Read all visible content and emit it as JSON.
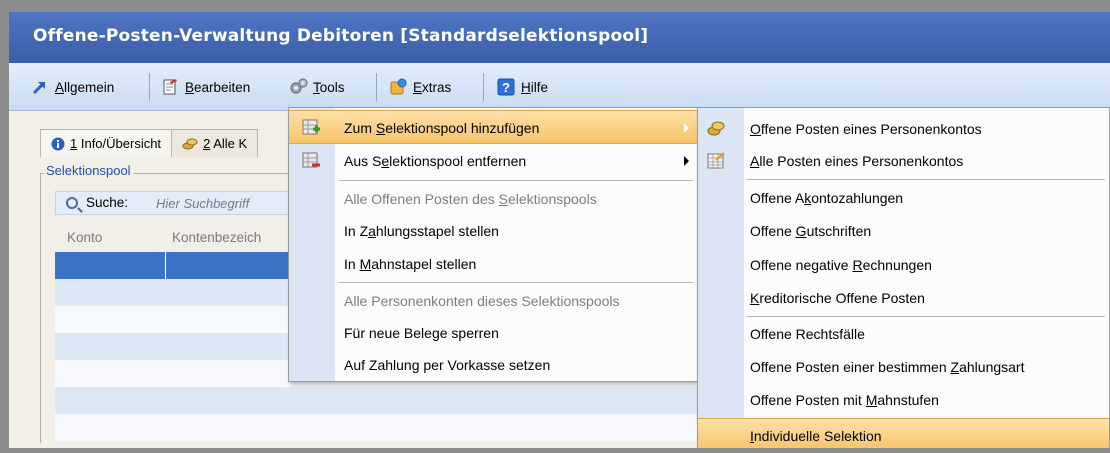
{
  "window": {
    "title": "Offene-Posten-Verwaltung Debitoren [Standardselektionspool]"
  },
  "toolbar": {
    "items": [
      {
        "label": "Allgemein",
        "accel": "A",
        "rest": "llgemein",
        "icon": "arrow-up-right-icon"
      },
      {
        "label": "Bearbeiten",
        "accel": "B",
        "rest": "earbeiten",
        "icon": "edit-icon"
      },
      {
        "label": "Tools",
        "accel": "T",
        "rest": "ools",
        "icon": "gears-icon"
      },
      {
        "label": "Extras",
        "accel": "E",
        "rest": "xtras",
        "icon": "extras-icon"
      },
      {
        "label": "Hilfe",
        "accel": "H",
        "rest": "ilfe",
        "icon": "help-icon"
      }
    ]
  },
  "tabs": [
    {
      "accel": "1",
      "rest": " Info/Übersicht",
      "icon": "info-icon"
    },
    {
      "accel": "2",
      "rest": " Alle K",
      "icon": "coins-icon"
    }
  ],
  "selektionspool": {
    "title": "Selektionspool",
    "search_label": "Suche:",
    "search_placeholder": "Hier Suchbegriff",
    "columns": [
      "Konto",
      "Kontenbezeich"
    ]
  },
  "menu_main": {
    "items": [
      {
        "pre": "Zum ",
        "accel": "S",
        "post": "elektionspool hinzufügen",
        "highlighted": true,
        "submenu": true,
        "icon": "add-pool-icon"
      },
      {
        "pre": "Aus S",
        "accel": "e",
        "post": "lektionspool entfernen",
        "submenu": true,
        "icon": "remove-pool-icon"
      },
      {
        "pre": "Alle Offenen Posten des ",
        "accel": "S",
        "post": "elektionspools",
        "disabled": true
      },
      {
        "pre": "In Z",
        "accel": "a",
        "post": "hlungsstapel stellen"
      },
      {
        "pre": "In ",
        "accel": "M",
        "post": "ahnstapel stellen"
      },
      {
        "pre": "Alle Personenkonten dieses Selektionspools",
        "accel": "",
        "post": "",
        "disabled": true
      },
      {
        "pre": "Für neue Belege sperren",
        "accel": "",
        "post": ""
      },
      {
        "pre": "Auf Zahlung per Vorkasse setzen",
        "accel": "",
        "post": ""
      }
    ]
  },
  "menu_sub": {
    "items": [
      {
        "pre": "",
        "accel": "O",
        "post": "ffene Posten eines Personenkontos",
        "icon": "coins-icon"
      },
      {
        "pre": "",
        "accel": "A",
        "post": "lle Posten eines Personenkontos",
        "icon": "list-icon"
      },
      {
        "pre": "Offene A",
        "accel": "k",
        "post": "ontozahlungen"
      },
      {
        "pre": "Offene ",
        "accel": "G",
        "post": "utschriften"
      },
      {
        "pre": "Offene negative ",
        "accel": "R",
        "post": "echnungen"
      },
      {
        "pre": "",
        "accel": "K",
        "post": "reditorische Offene Posten"
      },
      {
        "pre": "Offene Rechtsfälle",
        "accel": "",
        "post": ""
      },
      {
        "pre": "Offene Posten einer bestimmen ",
        "accel": "Z",
        "post": "ahlungsart"
      },
      {
        "pre": "Offene Posten mit ",
        "accel": "M",
        "post": "ahnstufen"
      },
      {
        "pre": "",
        "accel": "I",
        "post": "ndividuelle Selektion",
        "highlighted": true
      }
    ]
  },
  "colors": {
    "title_bar": "#3b5ea8",
    "selection_row": "#3e74c6",
    "menu_highlight": "#f7c468"
  }
}
